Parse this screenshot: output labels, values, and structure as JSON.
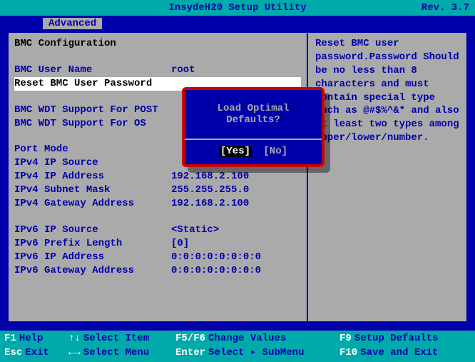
{
  "header": {
    "title": "InsydeH20 Setup Utility",
    "revision": "Rev. 3.7"
  },
  "tabs": {
    "active": "Advanced"
  },
  "main": {
    "section_title": "BMC Configuration",
    "items": [
      {
        "label": "BMC User Name",
        "value": "root"
      },
      {
        "label": "Reset BMC User Password",
        "value": ""
      },
      {
        "label": "BMC WDT Support For POST",
        "value": ""
      },
      {
        "label": "BMC WDT Support For OS",
        "value": ""
      },
      {
        "label": "Port Mode",
        "value": ""
      },
      {
        "label": "IPv4 IP Source",
        "value": ""
      },
      {
        "label": "IPv4 IP Address",
        "value": "192.168.2.100"
      },
      {
        "label": "IPv4 Subnet Mask",
        "value": "255.255.255.0"
      },
      {
        "label": "IPv4 Gateway Address",
        "value": "192.168.2.100"
      },
      {
        "label": "IPv6 IP Source",
        "value": "<Static>"
      },
      {
        "label": "IPv6 Prefix Length",
        "value": "[0]"
      },
      {
        "label": "IPv6 IP Address",
        "value": "0:0:0:0:0:0:0:0"
      },
      {
        "label": "IPv6 Gateway Address",
        "value": "0:0:0:0:0:0:0:0"
      }
    ]
  },
  "help": {
    "text": "Reset BMC user password.Password Should be no less than 8 characters and must contain special type such as @#$%^&* and also at least two types among upper/lower/number."
  },
  "dialog": {
    "title": "Load Optimal Defaults?",
    "yes": "[Yes]",
    "no": "[No]"
  },
  "footer": {
    "f1": "F1",
    "help": "Help",
    "updown": "↑↓",
    "select_item": "Select Item",
    "f5f6": "F5/F6",
    "change_values": "Change Values",
    "f9": "F9",
    "setup_defaults": "Setup Defaults",
    "esc": "Esc",
    "exit": "Exit",
    "leftright": "←→",
    "select_menu": "Select Menu",
    "enter": "Enter",
    "select_submenu": "Select ▸ SubMenu",
    "f10": "F10",
    "save_exit": "Save and Exit"
  }
}
